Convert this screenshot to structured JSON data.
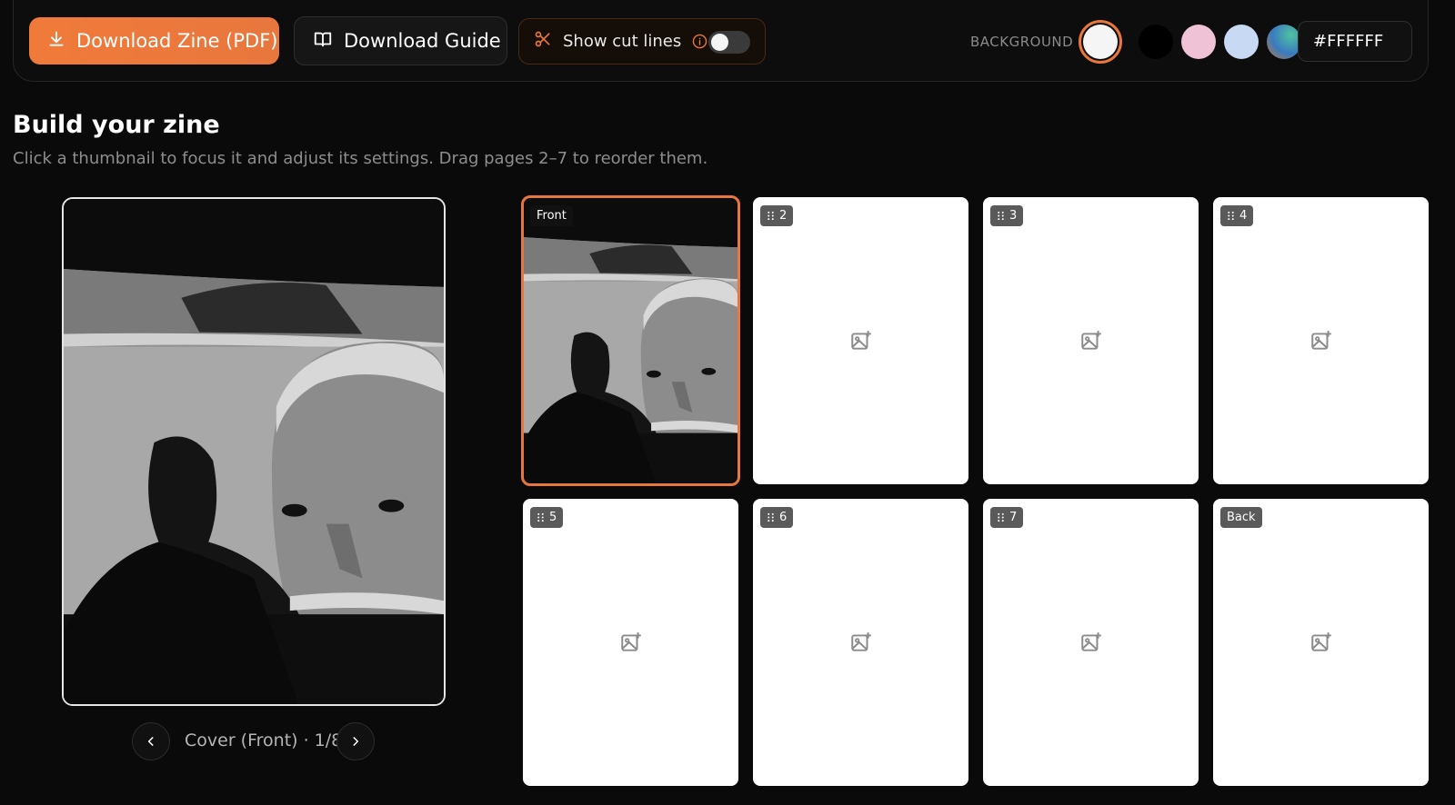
{
  "toolbar": {
    "download_zine_label": "Download Zine (PDF)",
    "download_guide_label": "Download Guide",
    "cut_lines_label": "Show cut lines",
    "cut_lines_on": false,
    "background_label": "BACKGROUND",
    "swatches": [
      {
        "name": "white",
        "color": "#f5f5f5",
        "selected": true
      },
      {
        "name": "black",
        "color": "#000000",
        "selected": false
      },
      {
        "name": "pink",
        "color": "#efc2d6",
        "selected": false
      },
      {
        "name": "light-blue",
        "color": "#c7d9f3",
        "selected": false
      },
      {
        "name": "gradient",
        "color": "gradient",
        "selected": false
      }
    ],
    "hex_value": "#FFFFFF"
  },
  "main": {
    "title": "Build your zine",
    "subtitle": "Click a thumbnail to focus it and adjust its settings. Drag pages 2–7 to reorder them.",
    "page_counter": "Cover (Front) · 1/8"
  },
  "pages": [
    {
      "label": "Front",
      "has_image": true,
      "active": true,
      "draggable": false
    },
    {
      "label": "2",
      "has_image": false,
      "active": false,
      "draggable": true
    },
    {
      "label": "3",
      "has_image": false,
      "active": false,
      "draggable": true
    },
    {
      "label": "4",
      "has_image": false,
      "active": false,
      "draggable": true
    },
    {
      "label": "5",
      "has_image": false,
      "active": false,
      "draggable": true
    },
    {
      "label": "6",
      "has_image": false,
      "active": false,
      "draggable": true
    },
    {
      "label": "7",
      "has_image": false,
      "active": false,
      "draggable": true
    },
    {
      "label": "Back",
      "has_image": false,
      "active": false,
      "draggable": false
    }
  ],
  "colors": {
    "accent": "#e8773d",
    "background": "#0a0a0a"
  }
}
